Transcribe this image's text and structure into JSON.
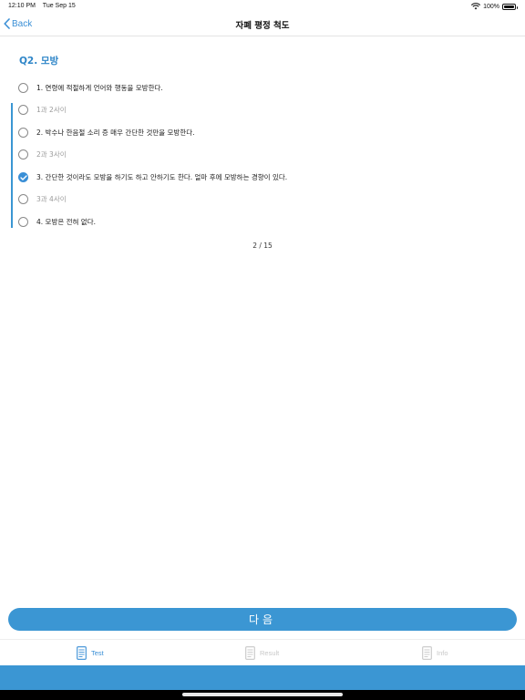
{
  "status": {
    "time": "12:10 PM",
    "date": "Tue Sep 15",
    "battery": "100%",
    "battery_level": 1.0
  },
  "nav": {
    "back_label": "Back",
    "title": "자폐 평정 척도"
  },
  "question": {
    "title": "Q2. 모방",
    "options": [
      {
        "label": "1. 연령에 적절하게 언어와 행동을 모방한다.",
        "checked": false,
        "kind": "main"
      },
      {
        "label": "1과 2사이",
        "checked": false,
        "kind": "mid"
      },
      {
        "label": "2. 박수나 한음절 소리 증 매우 간단한 것만을 모방한다.",
        "checked": false,
        "kind": "main"
      },
      {
        "label": "2과 3사이",
        "checked": false,
        "kind": "mid"
      },
      {
        "label": "3. 간단한 것이라도 모방을 하기도 하고 안하기도 한다. 얼마 후에 모방하는 경향이 있다.",
        "checked": true,
        "kind": "main"
      },
      {
        "label": "3과 4사이",
        "checked": false,
        "kind": "mid"
      },
      {
        "label": "4. 모방은 전혀 없다.",
        "checked": false,
        "kind": "main"
      }
    ]
  },
  "pager": {
    "text": "2 / 15"
  },
  "next_button": {
    "label": "다음"
  },
  "tabs": [
    {
      "label": "Test",
      "icon": "test-sheet-icon",
      "active": true
    },
    {
      "label": "Result",
      "icon": "result-sheet-icon",
      "active": false
    },
    {
      "label": "Info",
      "icon": "info-sheet-icon",
      "active": false
    }
  ],
  "colors": {
    "accent": "#3b96d3",
    "title_blue": "#2f86c8",
    "inactive_tab": "#c8c8c8"
  }
}
